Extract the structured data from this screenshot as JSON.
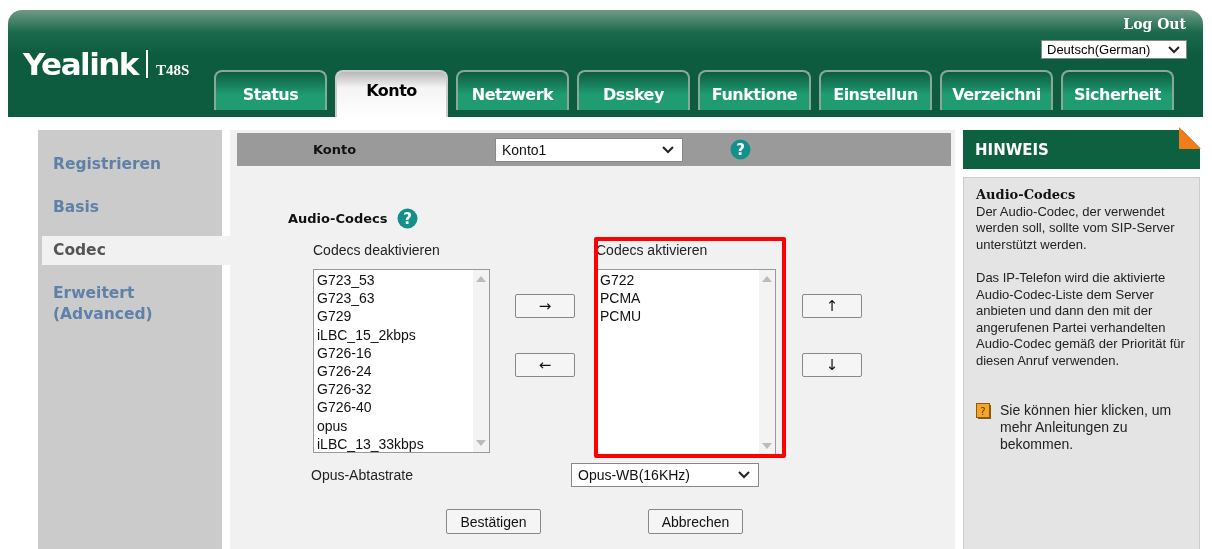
{
  "header": {
    "logo": "Yealink",
    "model": "T48S",
    "logout": "Log Out",
    "language": "Deutsch(German)"
  },
  "tabs": [
    {
      "label": "Status",
      "selected": false
    },
    {
      "label": "Konto",
      "selected": true
    },
    {
      "label": "Netzwerk",
      "selected": false
    },
    {
      "label": "Dsskey",
      "selected": false
    },
    {
      "label": "Funktione",
      "selected": false
    },
    {
      "label": "Einstellun",
      "selected": false
    },
    {
      "label": "Verzeichni",
      "selected": false
    },
    {
      "label": "Sicherheit",
      "selected": false
    }
  ],
  "sidebar": {
    "items": [
      {
        "label": "Registrieren",
        "selected": false
      },
      {
        "label": "Basis",
        "selected": false
      },
      {
        "label": "Codec",
        "selected": true
      },
      {
        "label": "Erweitert (Advanced)",
        "selected": false
      }
    ]
  },
  "account_bar": {
    "label": "Konto",
    "value": "Konto1",
    "help": "?"
  },
  "section_title": "Audio-Codecs",
  "section_help": "?",
  "disabled_codecs": {
    "label": "Codecs deaktivieren",
    "items": [
      "G723_53",
      "G723_63",
      "G729",
      "iLBC_15_2kbps",
      "G726-16",
      "G726-24",
      "G726-32",
      "G726-40",
      "opus",
      "iLBC_13_33kbps"
    ]
  },
  "enabled_codecs": {
    "label": "Codecs aktivieren",
    "items": [
      "G722",
      "PCMA",
      "PCMU"
    ],
    "highlighted": true
  },
  "move_buttons": [
    "→",
    "←"
  ],
  "order_buttons": [
    "↑",
    "↓"
  ],
  "opus_rate": {
    "label": "Opus-Abtastrate",
    "value": "Opus-WB(16KHz)"
  },
  "buttons": [
    "Bestätigen",
    "Abbrechen"
  ],
  "hint": {
    "title": "HINWEIS",
    "heading": "Audio-Codecs",
    "paragraphs": [
      "Der Audio-Codec, der verwendet werden soll, sollte vom SIP-Server unterstützt werden.",
      "Das IP-Telefon wird die aktivierte Audio-Codec-Liste dem Server anbieten und dann den mit der angerufenen Partei verhandelten Audio-Codec gemäß der Priorität für diesen Anruf verwenden."
    ],
    "link_icon": "?",
    "link": "Sie können hier klicken, um mehr Anleitungen zu bekommen."
  }
}
